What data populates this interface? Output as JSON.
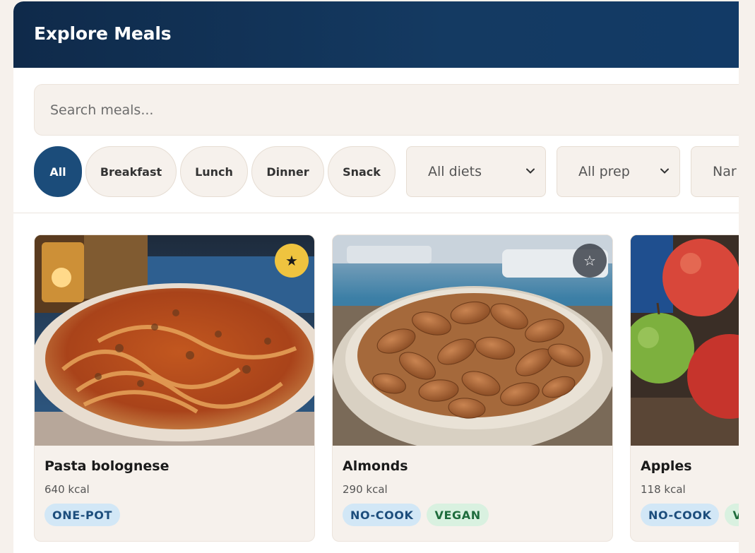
{
  "header": {
    "title": "Explore Meals"
  },
  "search": {
    "placeholder": "Search meals..."
  },
  "filters": {
    "chips": [
      {
        "label": "All",
        "active": true
      },
      {
        "label": "Breakfast",
        "active": false
      },
      {
        "label": "Lunch",
        "active": false
      },
      {
        "label": "Dinner",
        "active": false
      },
      {
        "label": "Snack",
        "active": false
      }
    ],
    "selects": [
      {
        "value": "All diets",
        "icon": "chevron-down-icon"
      },
      {
        "value": "All prep",
        "icon": "chevron-down-icon"
      },
      {
        "value": "Nar"
      }
    ]
  },
  "meals": [
    {
      "name": "Pasta bolognese",
      "kcal": "640 kcal",
      "favorite": true,
      "fav_icon": "star-filled-icon",
      "fav_glyph": "★",
      "tags": [
        {
          "label": "ONE-POT",
          "color": "blue"
        }
      ]
    },
    {
      "name": "Almonds",
      "kcal": "290 kcal",
      "favorite": false,
      "fav_icon": "star-outline-icon",
      "fav_glyph": "☆",
      "tags": [
        {
          "label": "NO-COOK",
          "color": "blue"
        },
        {
          "label": "VEGAN",
          "color": "green"
        }
      ]
    },
    {
      "name": "Apples",
      "kcal": "118 kcal",
      "tags": [
        {
          "label": "NO-COOK",
          "color": "blue"
        },
        {
          "label": "V",
          "color": "green"
        }
      ]
    }
  ],
  "colors": {
    "header": "#123a66",
    "accent": "#1b4c7a",
    "favorite": "#efc33f",
    "tag_blue": "#d2e7f6",
    "tag_green": "#d9f1e0"
  }
}
